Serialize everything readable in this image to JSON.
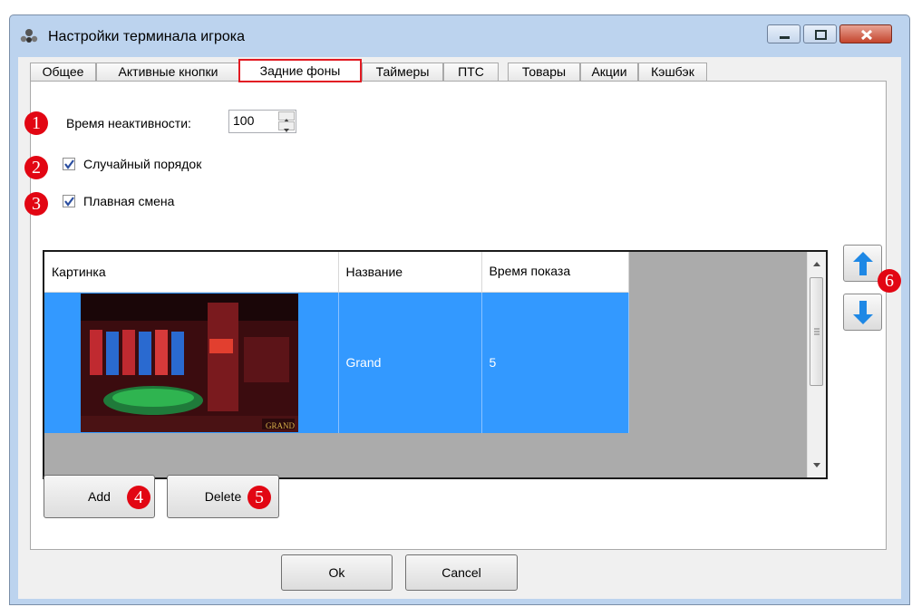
{
  "window": {
    "title": "Настройки терминала игрока"
  },
  "tabs": [
    "Общее",
    "Активные кнопки",
    "Задние фоны",
    "Таймеры",
    "ПТС",
    "Товары",
    "Акции",
    "Кэшбэк"
  ],
  "settings": {
    "inactivity_label": "Время неактивности:",
    "inactivity_value": "100",
    "random_order_label": "Случайный порядок",
    "random_order_checked": true,
    "smooth_change_label": "Плавная смена",
    "smooth_change_checked": true
  },
  "grid": {
    "columns": [
      "Картинка",
      "Название",
      "Время показа"
    ],
    "rows": [
      {
        "picture_caption": "GRAND",
        "name": "Grand",
        "time": "5"
      }
    ]
  },
  "buttons": {
    "add": "Add",
    "delete": "Delete",
    "ok": "Ok",
    "cancel": "Cancel"
  },
  "badges": [
    "1",
    "2",
    "3",
    "4",
    "5",
    "6"
  ],
  "icons": {
    "up": "arrow-up-icon",
    "down": "arrow-down-icon"
  },
  "colors": {
    "accent": "#e21b23",
    "selection": "#3399ff",
    "arrow": "#1e88e5"
  }
}
